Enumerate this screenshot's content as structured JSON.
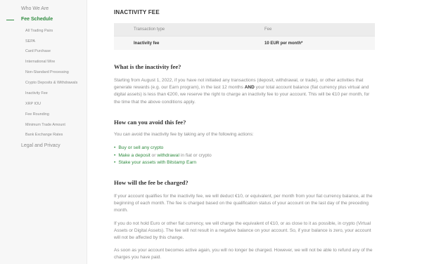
{
  "sidebar": {
    "who_we_are": "Who We Are",
    "fee_schedule": "Fee Schedule",
    "sub_items": [
      "All Trading Pairs",
      "SEPA",
      "Card Purchase",
      "International Wire",
      "Non-Standard Processing",
      "Crypto Deposits & Withdrawals",
      "Inactivity Fee",
      "XRP IOU",
      "Fee Rounding",
      "Minimum Trade Amount",
      "Bank Exchange Rates"
    ],
    "legal": "Legal and Privacy"
  },
  "section": {
    "title": "INACTIVITY FEE",
    "table": {
      "headers": [
        "Transaction type",
        "Fee"
      ],
      "rows": [
        [
          "Inactivity fee",
          "10 EUR per month*"
        ]
      ]
    }
  },
  "what": {
    "heading": "What is the inactivity fee?",
    "p1_a": "Starting from August 1, 2022, if you have not initiated any transactions (deposit, withdrawal, or trade), or other activities that generate rewards (e.g. our Earn program), in the last 12 months ",
    "p1_and": "AND",
    "p1_b": " your total account balance (fiat currency plus virtual and digital assets) is less than €200, we reserve the right to charge an inactivity fee to your account. This will be €10 per month, for the time that the above conditions apply."
  },
  "avoid": {
    "heading": "How can you avoid this fee?",
    "intro": "You can avoid the inactivity fee by taking any of the following actions:",
    "b1": "Buy or sell any crypto",
    "b2_link1": "Make a deposit",
    "b2_or": " or ",
    "b2_link2": "withdrawal",
    "b2_rest": " in fiat or crypto",
    "b3": "Stake your assets with Bitstamp Earn"
  },
  "charged": {
    "heading": "How will the fee be charged?",
    "p1": "If your account qualifies for the inactivity fee, we will deduct €10, or equivalent, per month from your fiat currency balance, at the beginning of each month. The fee is charged based on the qualification status of your account on the last day of the preceding month.",
    "p2": "If you do not hold Euro or other fiat currency, we will charge the equivalent of €10, or as close to it as possible, in crypto (Virtual Assets or Digital Assets). The fee will not result in a negative balance on your account. So, if your balance is zero, your account will not be affected by this change.",
    "p3": "As soon as your account becomes active again, you will no longer be charged. However, we will not be able to refund any of the charges you have paid."
  }
}
